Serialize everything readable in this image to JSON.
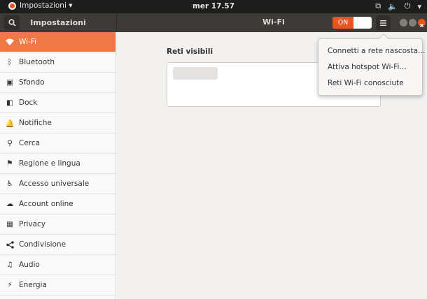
{
  "topbar": {
    "app_menu": "Impostazioni ▾",
    "clock": "mer 17.57",
    "tray": {
      "network": "⧉",
      "volume": "🔈",
      "power": "⏻",
      "power_menu": "▾"
    }
  },
  "header": {
    "sidebar_title": "Impostazioni",
    "page_title": "Wi-Fi",
    "switch_on_label": "ON",
    "menu_icon": "hamburger-icon"
  },
  "sidebar": {
    "items": [
      {
        "label": "Wi-Fi",
        "icon": "wifi-icon",
        "glyph": "",
        "active": true
      },
      {
        "label": "Bluetooth",
        "icon": "bluetooth-icon",
        "glyph": "ᛒ"
      },
      {
        "label": "Sfondo",
        "icon": "background-icon",
        "glyph": "▣"
      },
      {
        "label": "Dock",
        "icon": "dock-icon",
        "glyph": "◧"
      },
      {
        "label": "Notifiche",
        "icon": "bell-icon",
        "glyph": "🔔"
      },
      {
        "label": "Cerca",
        "icon": "search-icon",
        "glyph": "⚲"
      },
      {
        "label": "Regione e lingua",
        "icon": "flag-icon",
        "glyph": "⚑"
      },
      {
        "label": "Accesso universale",
        "icon": "accessibility-icon",
        "glyph": "♿"
      },
      {
        "label": "Account online",
        "icon": "online-accounts-icon",
        "glyph": "☁"
      },
      {
        "label": "Privacy",
        "icon": "privacy-icon",
        "glyph": "▦"
      },
      {
        "label": "Condivisione",
        "icon": "share-icon",
        "glyph": "<"
      },
      {
        "label": "Audio",
        "icon": "speaker-icon",
        "glyph": "♫"
      },
      {
        "label": "Energia",
        "icon": "power-icon",
        "glyph": "⚡"
      }
    ]
  },
  "main": {
    "section_title": "Reti visibili"
  },
  "popover": {
    "items": [
      "Connetti a rete nascosta…",
      "Attiva hotspot Wi-Fi…",
      "Reti Wi-Fi conosciute"
    ]
  },
  "colors": {
    "accent": "#e95420",
    "sidebar_active": "#f07746",
    "header_bg": "#3c3b37",
    "topbar_bg": "#1d1d1d"
  }
}
